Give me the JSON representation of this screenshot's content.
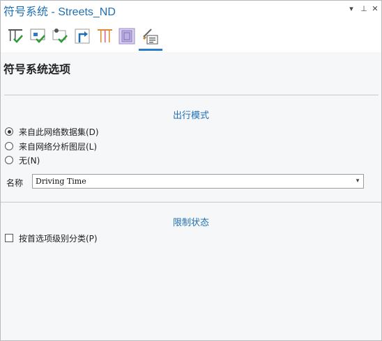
{
  "window": {
    "title": "符号系统 - Streets_ND",
    "controls": {
      "menu": "▾",
      "pin": "⊥",
      "close": "✕"
    }
  },
  "toolbar": {
    "tools": [
      {
        "icon": "primary-symbology-icon"
      },
      {
        "icon": "secondary-symbology-icon"
      },
      {
        "icon": "point-symbology-icon"
      },
      {
        "icon": "turn-symbology-icon"
      },
      {
        "icon": "attribute-table-icon"
      },
      {
        "icon": "display-filter-icon"
      },
      {
        "icon": "symbology-options-icon",
        "active": true
      }
    ]
  },
  "section_title": "符号系统选项",
  "travel_mode": {
    "heading": "出行模式",
    "options": [
      {
        "label": "来自此网络数据集(D)",
        "checked": true
      },
      {
        "label": "来自网络分析图层(L)",
        "checked": false
      },
      {
        "label": "无(N)",
        "checked": false
      }
    ],
    "name_label": "名称",
    "name_value": "Driving Time"
  },
  "restriction": {
    "heading": "限制状态",
    "checkbox_label": "按首选项级别分类(P)",
    "checked": false
  },
  "colors": {
    "accent": "#1e6fb3",
    "tab_underline": "#2a7bc8"
  }
}
